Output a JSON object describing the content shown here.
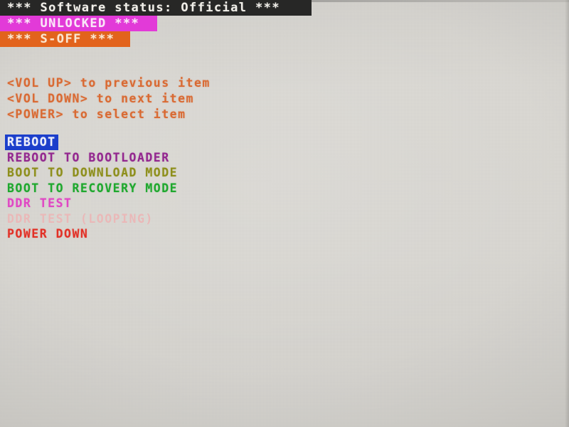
{
  "device_screen": {
    "kind": "android-bootloader-fastboot-menu",
    "background_color": "#d8d6d1"
  },
  "status": {
    "software": {
      "text": "*** Software status: Official ***",
      "background_color": "#272726",
      "text_color": "#f1efe9"
    },
    "unlocked": {
      "text": "*** UNLOCKED ***",
      "background_color": "#e23ad8",
      "text_color": "#fbe7f8"
    },
    "s_off": {
      "text": "*** S-OFF ***",
      "background_color": "#e2631c",
      "text_color": "#fbe6cf"
    }
  },
  "hints": {
    "color": "#d96a33",
    "lines": [
      "<VOL UP> to previous item",
      "<VOL DOWN> to next item",
      "<POWER> to select item"
    ]
  },
  "menu": {
    "selected_index": 0,
    "selected_background": "#1b3ecb",
    "selected_text_color": "#eef0fb",
    "items": [
      {
        "label": "REBOOT",
        "color": "#eef0fb",
        "state": "selected"
      },
      {
        "label": "REBOOT TO BOOTLOADER",
        "color": "#93278f",
        "state": "normal"
      },
      {
        "label": "BOOT TO DOWNLOAD MODE",
        "color": "#8e8f1c",
        "state": "normal"
      },
      {
        "label": "BOOT TO RECOVERY MODE",
        "color": "#1fa82e",
        "state": "normal"
      },
      {
        "label": "DDR TEST",
        "color": "#e047c4",
        "state": "normal"
      },
      {
        "label": "DDR TEST (LOOPING)",
        "color": "#eab8b8",
        "state": "dimmed"
      },
      {
        "label": "POWER DOWN",
        "color": "#e23127",
        "state": "normal"
      }
    ]
  }
}
